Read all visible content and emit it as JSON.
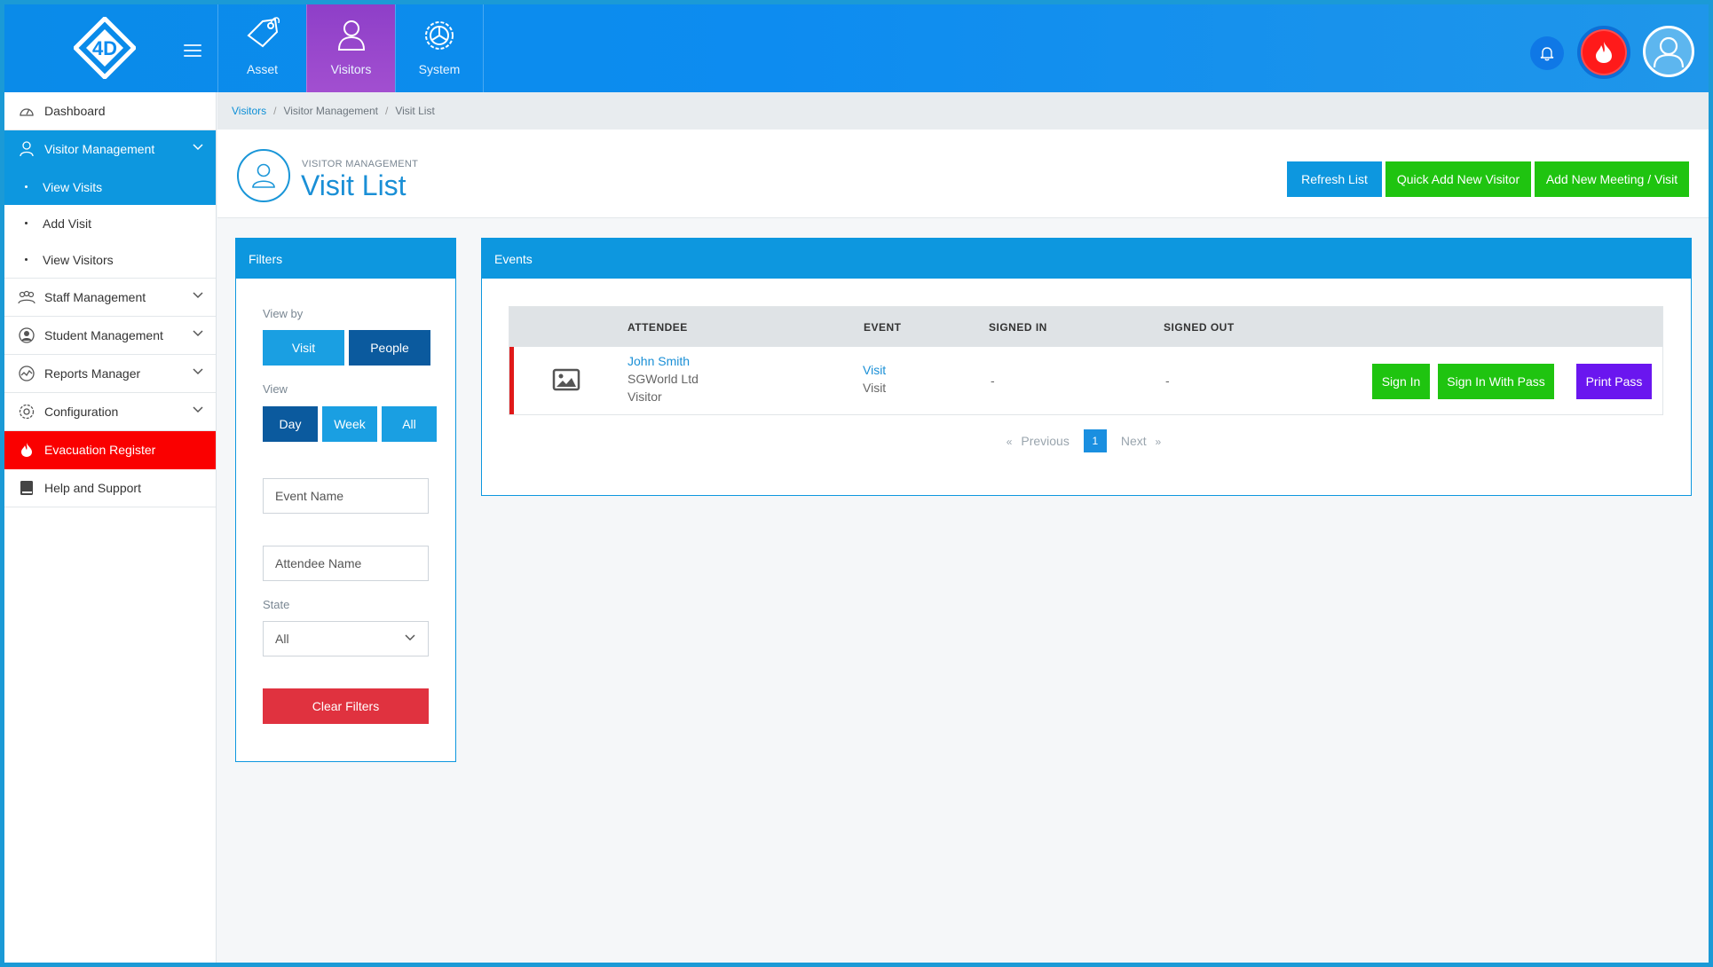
{
  "topnav": {
    "tabs": [
      {
        "label": "Asset",
        "icon": "tag-icon"
      },
      {
        "label": "Visitors",
        "icon": "user-icon",
        "active": true
      },
      {
        "label": "System",
        "icon": "gear-icon"
      }
    ]
  },
  "sidebar": {
    "items": [
      {
        "label": "Dashboard",
        "icon": "dashboard-icon"
      },
      {
        "label": "Visitor Management",
        "icon": "user-icon",
        "expanded": true
      },
      {
        "label": "Staff Management",
        "icon": "group-icon"
      },
      {
        "label": "Student Management",
        "icon": "student-icon"
      },
      {
        "label": "Reports Manager",
        "icon": "chart-icon"
      },
      {
        "label": "Configuration",
        "icon": "gear-icon"
      },
      {
        "label": "Evacuation Register",
        "icon": "flame-icon"
      },
      {
        "label": "Help and Support",
        "icon": "book-icon"
      }
    ],
    "sub_items": [
      {
        "label": "View Visits",
        "active": true
      },
      {
        "label": "Add Visit"
      },
      {
        "label": "View Visitors"
      }
    ]
  },
  "breadcrumb": {
    "items": [
      "Visitors",
      "Visitor Management",
      "Visit List"
    ],
    "separator": "/"
  },
  "header": {
    "subtitle": "VISITOR MANAGEMENT",
    "title": "Visit List",
    "refresh_label": "Refresh List",
    "quick_add_label": "Quick Add New Visitor",
    "add_meeting_label": "Add New Meeting / Visit"
  },
  "filters": {
    "title": "Filters",
    "view_by_label": "View by",
    "view_by_options": [
      "Visit",
      "People"
    ],
    "view_by_selected": "People",
    "view_label": "View",
    "view_options": [
      "Day",
      "Week",
      "All"
    ],
    "view_selected": "Day",
    "event_name_placeholder": "Event Name",
    "attendee_name_placeholder": "Attendee Name",
    "state_label": "State",
    "state_value": "All",
    "clear_label": "Clear Filters"
  },
  "events": {
    "title": "Events",
    "columns": [
      "ATTENDEE",
      "EVENT",
      "SIGNED IN",
      "SIGNED OUT"
    ],
    "rows": [
      {
        "attendee_name": "John Smith",
        "attendee_company": "SGWorld Ltd",
        "attendee_type": "Visitor",
        "event_link": "Visit",
        "event_type": "Visit",
        "signed_in": "-",
        "signed_out": "-",
        "sign_in_label": "Sign In",
        "sign_in_pass_label": "Sign In With Pass",
        "print_pass_label": "Print Pass"
      }
    ],
    "pagination": {
      "prev_arrow": "«",
      "prev_label": "Previous",
      "current_page": "1",
      "next_label": "Next",
      "next_arrow": "»"
    }
  },
  "colors": {
    "primary": "#0d97df",
    "active_tab": "#9a48cd",
    "success": "#1fc410",
    "danger": "#e0323f",
    "evacuation": "#fa0000",
    "print": "#6a16ef"
  }
}
